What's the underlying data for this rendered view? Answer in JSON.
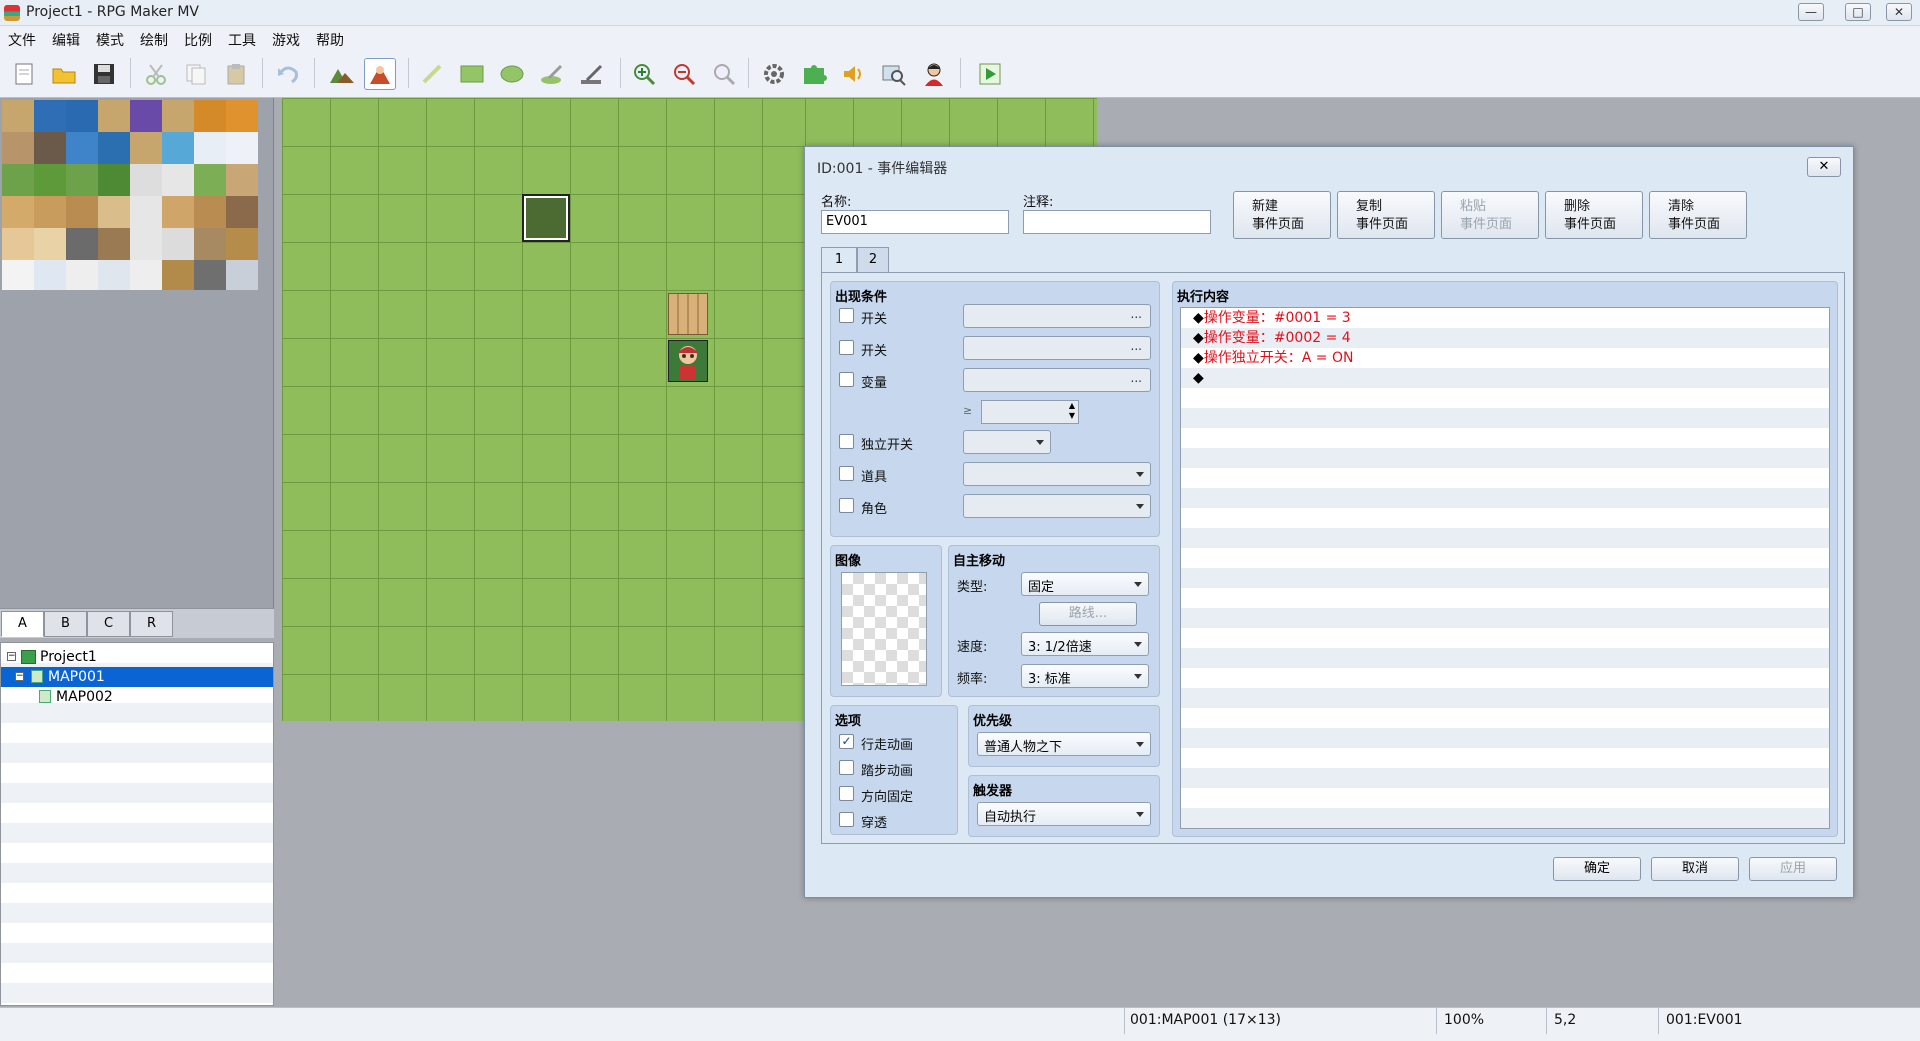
{
  "window": {
    "title": "Project1 - RPG Maker MV",
    "min": "—",
    "max": "□",
    "close": "✕"
  },
  "menu": [
    "文件",
    "编辑",
    "模式",
    "绘制",
    "比例",
    "工具",
    "游戏",
    "帮助"
  ],
  "toolbar": [
    "new-project-icon",
    "open-project-icon",
    "save-project-icon",
    "cut-icon",
    "copy-icon",
    "paste-icon",
    "undo-icon",
    "map-mode-icon",
    "event-mode-icon",
    "pencil-icon",
    "rectangle-icon",
    "ellipse-icon",
    "flood-fill-icon",
    "shadow-pen-icon",
    "zoom-in-icon",
    "zoom-out-icon",
    "zoom-actual-icon",
    "database-icon",
    "plugin-manager-icon",
    "sound-test-icon",
    "event-searcher-icon",
    "character-generator-icon",
    "playtest-icon"
  ],
  "tile_tabs": [
    "A",
    "B",
    "C",
    "R"
  ],
  "map_tree": {
    "project": "Project1",
    "maps": [
      "MAP001",
      "MAP002"
    ]
  },
  "dialog": {
    "title": "ID:001 - 事件编辑器",
    "name_label": "名称:",
    "name_value": "EV001",
    "note_label": "注释:",
    "note_value": "",
    "page_buttons": [
      {
        "l1": "新建",
        "l2": "事件页面"
      },
      {
        "l1": "复制",
        "l2": "事件页面"
      },
      {
        "l1": "粘贴",
        "l2": "事件页面"
      },
      {
        "l1": "删除",
        "l2": "事件页面"
      },
      {
        "l1": "清除",
        "l2": "事件页面"
      }
    ],
    "pages": [
      "1",
      "2"
    ],
    "conditions": {
      "title": "出现条件",
      "switch1": "开关",
      "switch2": "开关",
      "variable": "变量",
      "gte": "≥",
      "self_switch": "独立开关",
      "item": "道具",
      "actor": "角色",
      "dots": "..."
    },
    "image": {
      "title": "图像"
    },
    "autonomous": {
      "title": "自主移动",
      "type_label": "类型:",
      "type_value": "固定",
      "route_button": "路线...",
      "speed_label": "速度:",
      "speed_value": "3: 1/2倍速",
      "freq_label": "频率:",
      "freq_value": "3: 标准"
    },
    "options": {
      "title": "选项",
      "walking": "行走动画",
      "stepping": "踏步动画",
      "direction_fix": "方向固定",
      "through": "穿透",
      "walking_checked": "✓"
    },
    "priority": {
      "title": "优先级",
      "value": "普通人物之下"
    },
    "trigger": {
      "title": "触发器",
      "value": "自动执行"
    },
    "contents": {
      "title": "执行内容",
      "bullet": "◆",
      "commands": [
        "操作变量：#0001 = 3",
        "操作变量：#0002 = 4",
        "操作独立开关：A = ON",
        ""
      ]
    },
    "ok": "确定",
    "cancel": "取消",
    "apply": "应用"
  },
  "status": {
    "map": "001:MAP001 (17×13)",
    "zoom": "100%",
    "coords": "5,2",
    "event": "001:EV001"
  }
}
